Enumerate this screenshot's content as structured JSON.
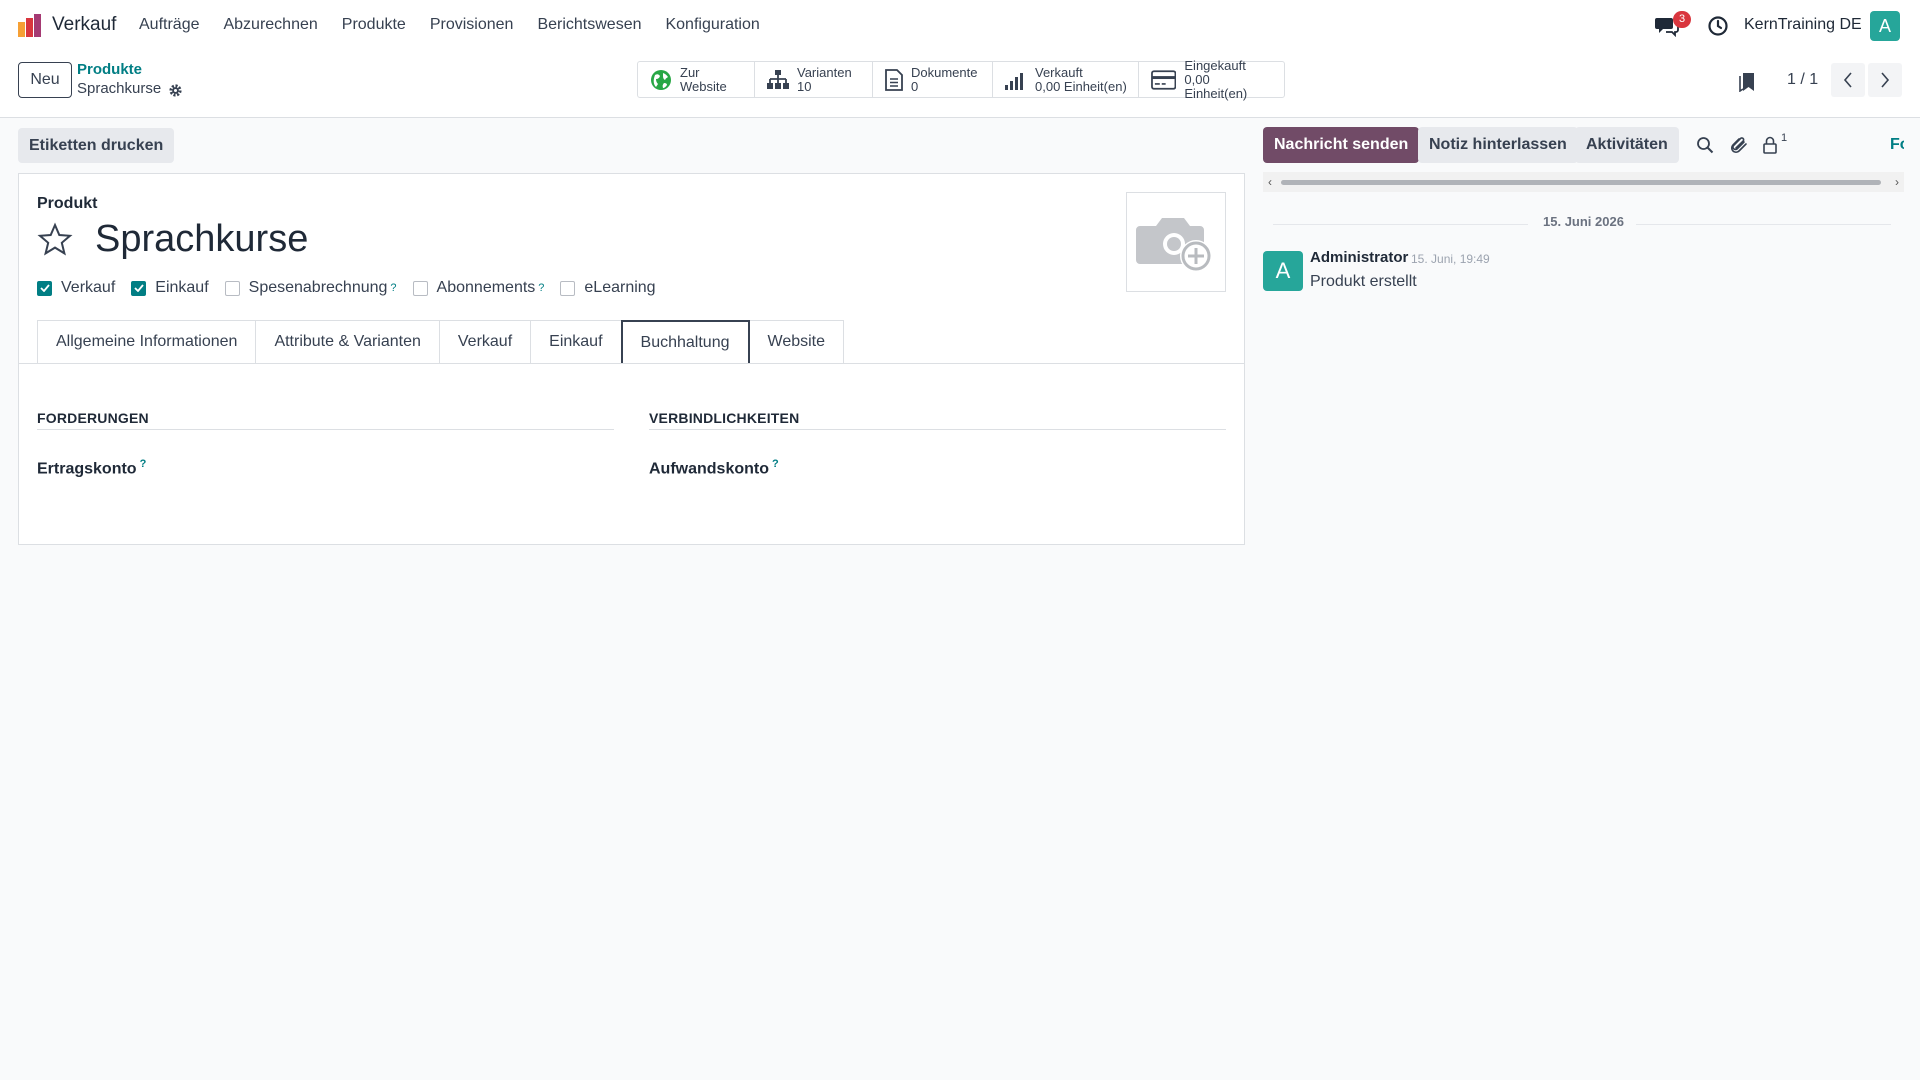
{
  "nav": {
    "app_name": "Verkauf",
    "menu": [
      "Aufträge",
      "Abzurechnen",
      "Produkte",
      "Provisionen",
      "Berichtswesen",
      "Konfiguration"
    ],
    "chat_count": "3",
    "company": "KernTraining DE",
    "avatar": "A"
  },
  "control": {
    "new_label": "Neu",
    "breadcrumb_parent": "Produkte",
    "breadcrumb_current": "Sprachkurse",
    "smart_buttons": [
      {
        "label": "Zur",
        "value": "Website",
        "icon": "globe-icon"
      },
      {
        "label": "Varianten",
        "value": "10",
        "icon": "sitemap-icon"
      },
      {
        "label": "Dokumente",
        "value": "0",
        "icon": "document-icon"
      },
      {
        "label": "Verkauft",
        "value": "0,00 Einheit(en)",
        "icon": "signal-icon"
      },
      {
        "label": "Eingekauft",
        "value": "0,00 Einheit(en)",
        "icon": "credit-card-icon"
      }
    ],
    "pager": "1 / 1"
  },
  "form": {
    "print_labels": "Etiketten drucken",
    "product_label": "Produkt",
    "product_name": "Sprachkurse",
    "checkboxes": [
      {
        "label": "Verkauf",
        "checked": true,
        "tooltip": ""
      },
      {
        "label": "Einkauf",
        "checked": true,
        "tooltip": ""
      },
      {
        "label": "Spesenabrechnung",
        "checked": false,
        "tooltip": "?"
      },
      {
        "label": "Abonnements",
        "checked": false,
        "tooltip": "?"
      },
      {
        "label": "eLearning",
        "checked": false,
        "tooltip": ""
      }
    ],
    "tabs": [
      "Allgemeine Informationen",
      "Attribute & Varianten",
      "Verkauf",
      "Einkauf",
      "Buchhaltung",
      "Website"
    ],
    "active_tab": "Buchhaltung",
    "receivables_title": "FORDERUNGEN",
    "income_account": "Ertragskonto",
    "payables_title": "VERBINDLICHKEITEN",
    "expense_account": "Aufwandskonto",
    "tooltip_mark": "?"
  },
  "chatter": {
    "send_message": "Nachricht senden",
    "log_note": "Notiz hinterlassen",
    "activities": "Aktivitäten",
    "followers_count": "1",
    "follow_label": "Fo",
    "date_separator": "15. Juni 2026",
    "message": {
      "avatar": "A",
      "author": "Administrator",
      "time": "15. Juni, 19:49",
      "body": "Produkt erstellt"
    }
  },
  "colors": {
    "primary": "#714b67",
    "accent": "#017e84",
    "avatar": "#26a69a",
    "badge": "#d9363e"
  }
}
